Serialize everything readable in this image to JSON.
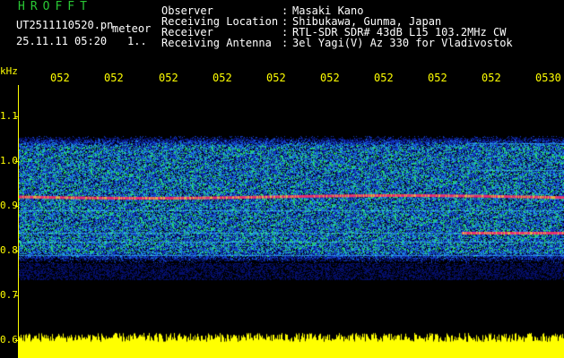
{
  "header": {
    "title": "HROFFT",
    "filename": "UT2511110520.pn",
    "kind": "meteor",
    "datetime": "25.11.11 05:20",
    "extra": "1.."
  },
  "info": [
    {
      "label": "Observer",
      "value": "Masaki Kano"
    },
    {
      "label": "Receiving Location",
      "value": "Shibukawa, Gunma, Japan"
    },
    {
      "label": "Receiver",
      "value": "RTL-SDR SDR# 43dB L15 103.2MHz CW"
    },
    {
      "label": "Receiving Antenna",
      "value": "3el Yagi(V) Az 330 for Vladivostok"
    }
  ],
  "axis": {
    "y_unit": "kHz",
    "y_ticks": [
      "1.1",
      "1.0",
      "0.9",
      "0.8",
      "0.7",
      "0.6"
    ],
    "x_ticks": [
      "052",
      "052",
      "052",
      "052",
      "052",
      "052",
      "052",
      "052",
      "052",
      "0530"
    ]
  },
  "colors": {
    "axis": "#ffff00",
    "title": "#29c734",
    "text": "#ffffff",
    "background": "#000000",
    "noise_dark": "#0a1a8c",
    "noise_mid": "#1f6fe0",
    "signal": "#ff2a6a"
  },
  "chart_data": {
    "type": "heatmap",
    "ylabel": "kHz",
    "ylim": [
      0.6,
      1.1
    ],
    "x_tick_labels": [
      "052",
      "052",
      "052",
      "052",
      "052",
      "052",
      "052",
      "052",
      "052",
      "0530"
    ],
    "y_tick_labels": [
      "1.1",
      "1.0",
      "0.9",
      "0.8",
      "0.7",
      "0.6"
    ],
    "carrier_khz": 0.92,
    "secondary_lines_khz": [
      1.04,
      0.98,
      0.89,
      0.84,
      0.82,
      0.79
    ]
  }
}
